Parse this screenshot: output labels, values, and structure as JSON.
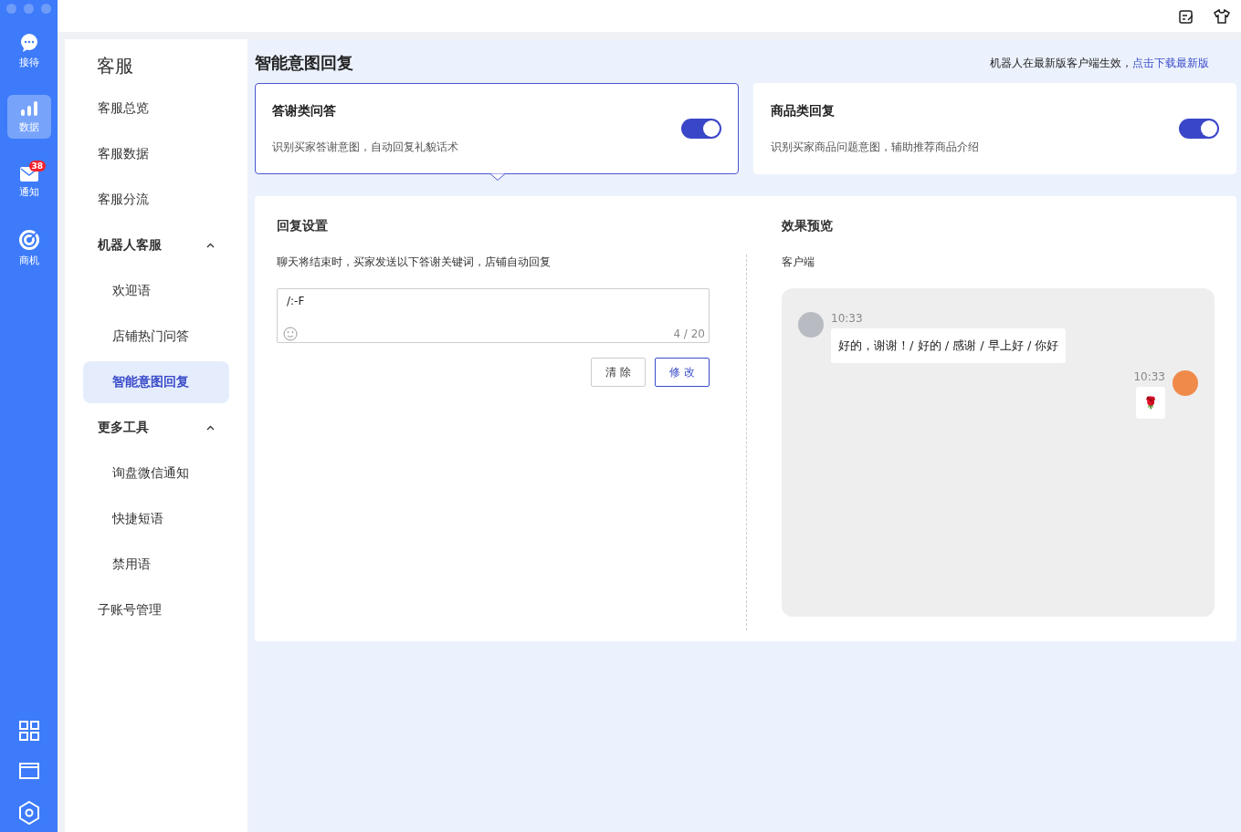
{
  "rail": {
    "items": [
      {
        "label": "接待",
        "selected": false
      },
      {
        "label": "数据",
        "selected": true
      },
      {
        "label": "通知",
        "selected": false,
        "badge": "38"
      },
      {
        "label": "商机",
        "selected": false
      }
    ]
  },
  "nav": {
    "title": "客服",
    "items": [
      {
        "label": "客服总览"
      },
      {
        "label": "客服数据"
      },
      {
        "label": "客服分流"
      },
      {
        "label": "机器人客服",
        "expanded": true,
        "children": [
          {
            "label": "欢迎语",
            "selected": false
          },
          {
            "label": "店铺热门问答",
            "selected": false
          },
          {
            "label": "智能意图回复",
            "selected": true
          }
        ]
      },
      {
        "label": "更多工具",
        "expanded": true,
        "children": [
          {
            "label": "询盘微信通知",
            "selected": false
          },
          {
            "label": "快捷短语",
            "selected": false
          },
          {
            "label": "禁用语",
            "selected": false
          }
        ]
      },
      {
        "label": "子账号管理"
      }
    ]
  },
  "page": {
    "title": "智能意图回复",
    "notice": "机器人在最新版客户端生效，",
    "notice_link": "点击下载最新版"
  },
  "cards": [
    {
      "title": "答谢类问答",
      "desc": "识别买家答谢意图，自动回复礼貌话术",
      "on": true,
      "selected": true
    },
    {
      "title": "商品类回复",
      "desc": "识别买家商品问题意图，辅助推荐商品介绍",
      "on": true,
      "selected": false
    }
  ],
  "settings": {
    "title": "回复设置",
    "hint": "聊天将结束时，买家发送以下答谢关键词，店铺自动回复",
    "value": "/:-F",
    "count": "4 / 20",
    "buttons": [
      {
        "label": "清 除",
        "kind": "plain"
      },
      {
        "label": "修 改",
        "kind": "primary"
      }
    ]
  },
  "preview": {
    "title": "效果预览",
    "subtitle": "客户端",
    "messages": [
      {
        "kind": "incoming",
        "time": "10:33",
        "text": "好的，谢谢！/ 好的 / 感谢 / 早上好 / 你好"
      },
      {
        "kind": "outgoing",
        "time": "10:33",
        "text": "🌹"
      }
    ]
  }
}
